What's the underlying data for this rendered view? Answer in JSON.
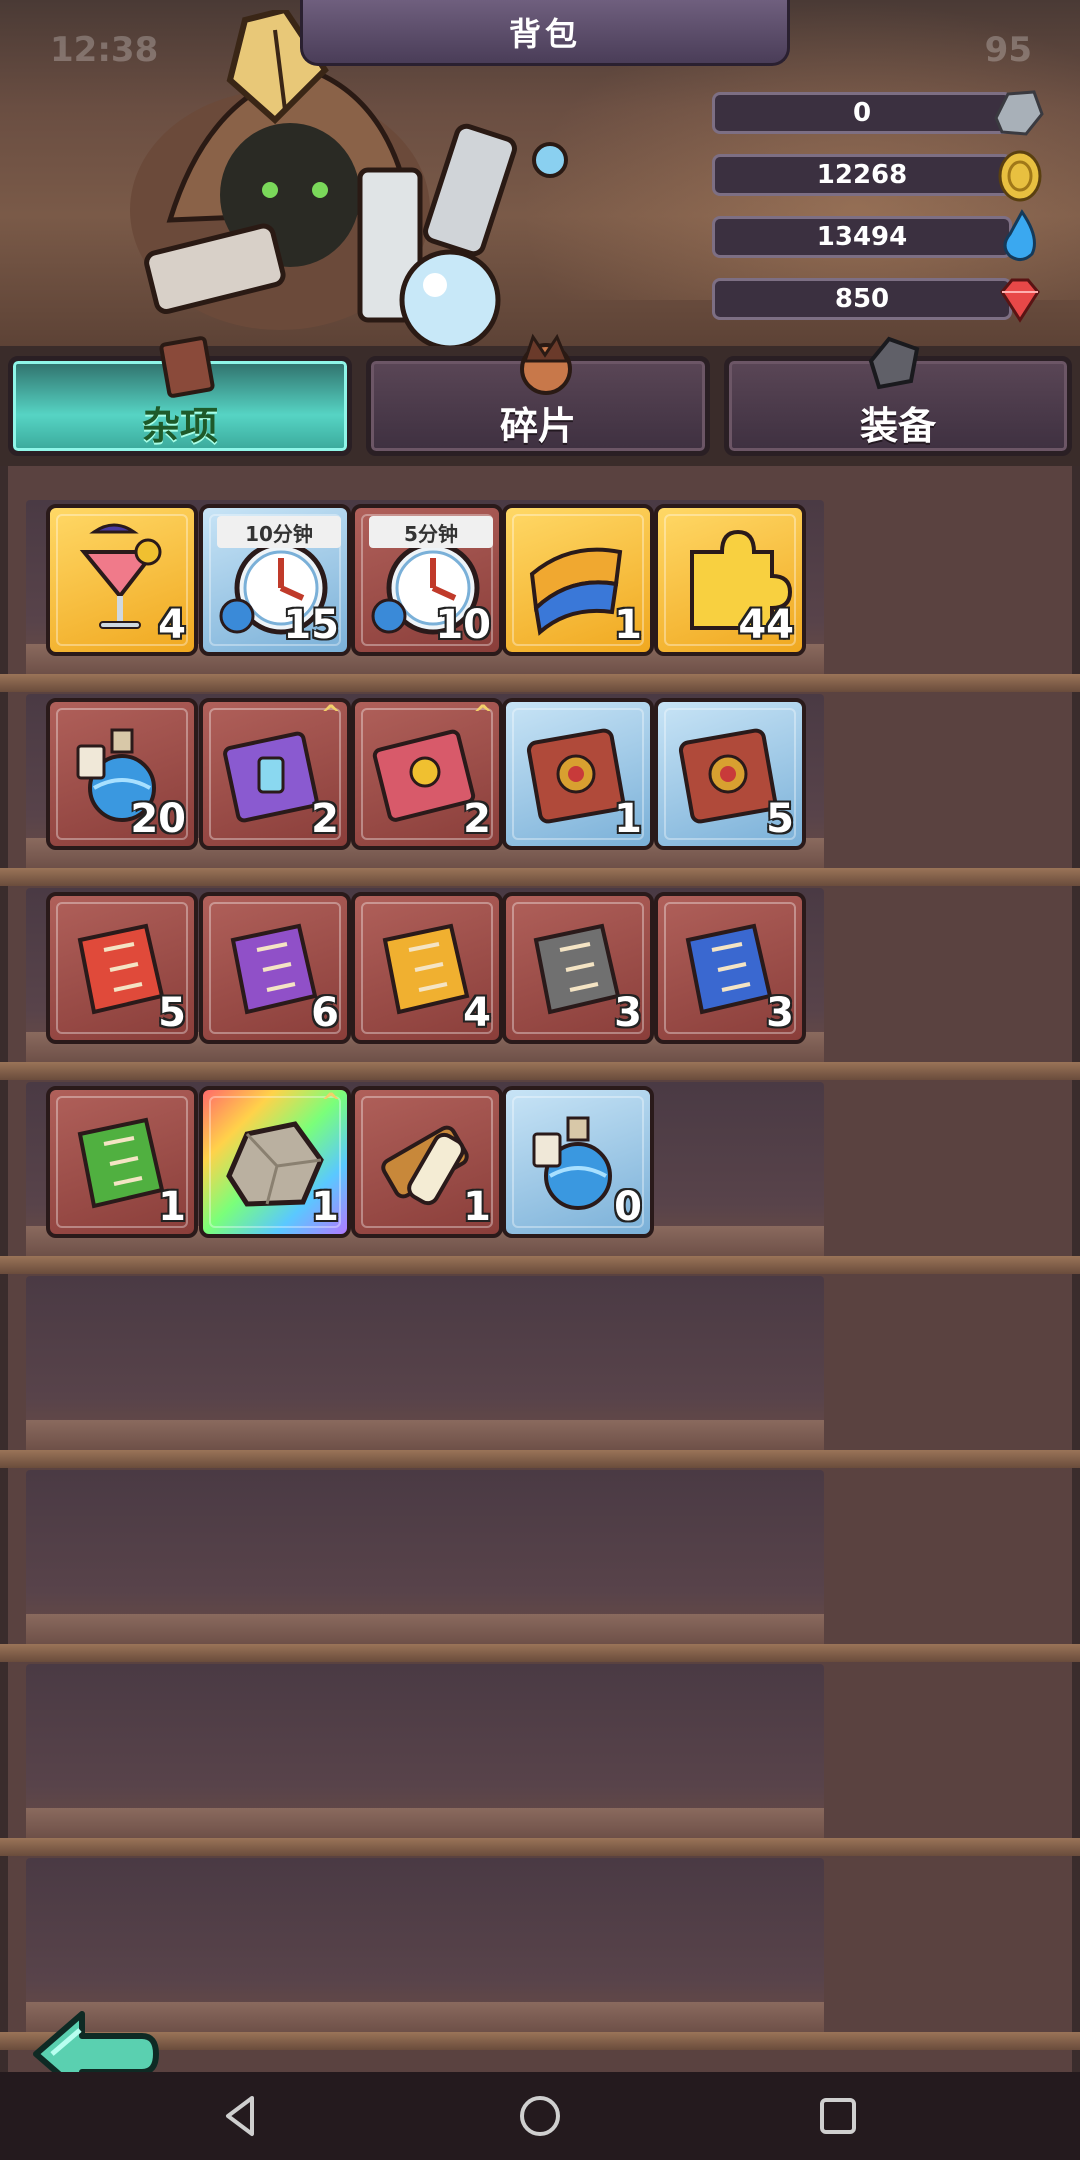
{
  "status": {
    "time": "12:38",
    "battery": "95"
  },
  "title": "背包",
  "resources": [
    {
      "value": "0",
      "icon": "stone-icon",
      "color": "#a8b0b8"
    },
    {
      "value": "12268",
      "icon": "gold-coin-icon",
      "color": "#e8c040"
    },
    {
      "value": "13494",
      "icon": "water-drop-icon",
      "color": "#3aa8f0"
    },
    {
      "value": "850",
      "icon": "red-gem-icon",
      "color": "#e84848"
    }
  ],
  "tabs": [
    {
      "label": "杂项",
      "active": true
    },
    {
      "label": "碎片",
      "active": false
    },
    {
      "label": "装备",
      "active": false
    }
  ],
  "items": [
    {
      "name": "cocktail",
      "qty": "4",
      "rarity": "gold",
      "icon": "cocktail-icon"
    },
    {
      "name": "speedup-10min",
      "qty": "15",
      "rarity": "blue",
      "icon": "clock-potion-icon",
      "timer": "10分钟"
    },
    {
      "name": "speedup-5min",
      "qty": "10",
      "rarity": "red",
      "icon": "clock-potion-icon",
      "timer": "5分钟"
    },
    {
      "name": "ticket",
      "qty": "1",
      "rarity": "gold",
      "icon": "ticket-icon"
    },
    {
      "name": "puzzle-piece",
      "qty": "44",
      "rarity": "gold",
      "icon": "puzzle-piece-icon"
    },
    {
      "name": "blue-potion",
      "qty": "20",
      "rarity": "red",
      "icon": "potion-bottle-icon"
    },
    {
      "name": "purple-potion-book",
      "qty": "2",
      "rarity": "red",
      "icon": "spell-book-icon",
      "upgrade": true
    },
    {
      "name": "red-gear-book",
      "qty": "2",
      "rarity": "red",
      "icon": "gear-book-icon",
      "upgrade": true
    },
    {
      "name": "red-ornate-book",
      "qty": "1",
      "rarity": "blue",
      "icon": "ornate-book-icon"
    },
    {
      "name": "green-ornate-book",
      "qty": "5",
      "rarity": "blue",
      "icon": "ornate-book-icon"
    },
    {
      "name": "red-scroll",
      "qty": "5",
      "rarity": "red",
      "icon": "scroll-icon",
      "color": "#e04a3a"
    },
    {
      "name": "purple-scroll",
      "qty": "6",
      "rarity": "red",
      "icon": "scroll-icon",
      "color": "#9050c8"
    },
    {
      "name": "yellow-scroll",
      "qty": "4",
      "rarity": "red",
      "icon": "scroll-icon",
      "color": "#f0b030"
    },
    {
      "name": "gray-scroll",
      "qty": "3",
      "rarity": "red",
      "icon": "scroll-icon",
      "color": "#707070"
    },
    {
      "name": "blue-scroll",
      "qty": "3",
      "rarity": "red",
      "icon": "scroll-icon",
      "color": "#3a68d0"
    },
    {
      "name": "green-scroll",
      "qty": "1",
      "rarity": "red",
      "icon": "scroll-icon",
      "color": "#50b040"
    },
    {
      "name": "rock",
      "qty": "1",
      "rarity": "rainbow",
      "icon": "rock-icon",
      "upgrade": true
    },
    {
      "name": "brush-bottle",
      "qty": "1",
      "rarity": "red",
      "icon": "brush-bottle-icon"
    },
    {
      "name": "blue-potion-empty",
      "qty": "0",
      "rarity": "blue",
      "icon": "potion-bottle-icon"
    }
  ]
}
